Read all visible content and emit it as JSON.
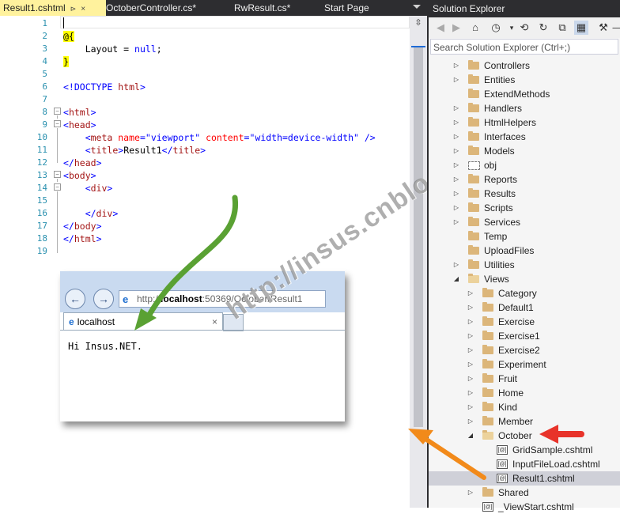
{
  "tabs": [
    {
      "label": "Result1.cshtml",
      "active": true
    },
    {
      "label": "OctoberController.cs*"
    },
    {
      "label": "RwResult.cs*"
    },
    {
      "label": "Start Page"
    }
  ],
  "tab_pin": "⊳",
  "tab_close": "×",
  "editor": {
    "line_numbers": [
      "1",
      "2",
      "3",
      "4",
      "5",
      "6",
      "7",
      "8",
      "9",
      "10",
      "11",
      "12",
      "13",
      "14",
      "15",
      "16",
      "17",
      "18",
      "19"
    ],
    "lines": {
      "l2": "@{",
      "l3a": "    Layout = ",
      "l3b": "null",
      "l3c": ";",
      "l4": "}",
      "l6a": "<!DOCTYPE ",
      "l6b": "html",
      "l6c": ">",
      "l8a": "<",
      "l8b": "html",
      "l8c": ">",
      "l9a": "<",
      "l9b": "head",
      "l9c": ">",
      "l10a": "    <",
      "l10b": "meta",
      "l10c": " name",
      "l10d": "=",
      "l10e": "\"viewport\"",
      "l10f": " content",
      "l10g": "=",
      "l10h": "\"width=device-width\"",
      "l10i": " />",
      "l11a": "    <",
      "l11b": "title",
      "l11c": ">",
      "l11d": "Result1",
      "l11e": "</",
      "l11f": "title",
      "l11g": ">",
      "l12a": "</",
      "l12b": "head",
      "l12c": ">",
      "l13a": "<",
      "l13b": "body",
      "l13c": ">",
      "l14a": "    <",
      "l14b": "div",
      "l14c": ">",
      "l16a": "    </",
      "l16b": "div",
      "l16c": ">",
      "l17a": "</",
      "l17b": "body",
      "l17c": ">",
      "l18a": "</",
      "l18b": "html",
      "l18c": ">"
    }
  },
  "browser": {
    "back": "←",
    "forward": "→",
    "ie_glyph": "e",
    "url_prefix": "http://",
    "url_host": "localhost",
    "url_rest": ":50369/October/Result1",
    "tab_label": "localhost",
    "tab_close": "×",
    "content": "Hi Insus.NET."
  },
  "watermark": "http://insus.cnblogs.com",
  "solution_explorer": {
    "title": "Solution Explorer",
    "search_placeholder": "Search Solution Explorer (Ctrl+;)",
    "toolbar_icons": [
      "back-icon",
      "forward-icon",
      "home-icon",
      "history-icon",
      "refresh-icon",
      "sync-icon",
      "collapse-icon",
      "show-all-icon",
      "properties-icon",
      "pin-icon"
    ],
    "items": [
      {
        "label": "Controllers",
        "level": 0,
        "expander": "collapsed",
        "kind": "folder"
      },
      {
        "label": "Entities",
        "level": 0,
        "expander": "collapsed",
        "kind": "folder"
      },
      {
        "label": "ExtendMethods",
        "level": 0,
        "expander": "none",
        "kind": "folder"
      },
      {
        "label": "Handlers",
        "level": 0,
        "expander": "collapsed",
        "kind": "folder"
      },
      {
        "label": "HtmlHelpers",
        "level": 0,
        "expander": "collapsed",
        "kind": "folder"
      },
      {
        "label": "Interfaces",
        "level": 0,
        "expander": "collapsed",
        "kind": "folder"
      },
      {
        "label": "Models",
        "level": 0,
        "expander": "collapsed",
        "kind": "folder"
      },
      {
        "label": "obj",
        "level": 0,
        "expander": "collapsed",
        "kind": "hidden-folder"
      },
      {
        "label": "Reports",
        "level": 0,
        "expander": "collapsed",
        "kind": "folder"
      },
      {
        "label": "Results",
        "level": 0,
        "expander": "collapsed",
        "kind": "folder"
      },
      {
        "label": "Scripts",
        "level": 0,
        "expander": "collapsed",
        "kind": "folder"
      },
      {
        "label": "Services",
        "level": 0,
        "expander": "collapsed",
        "kind": "folder"
      },
      {
        "label": "Temp",
        "level": 0,
        "expander": "none",
        "kind": "folder"
      },
      {
        "label": "UploadFiles",
        "level": 0,
        "expander": "none",
        "kind": "folder"
      },
      {
        "label": "Utilities",
        "level": 0,
        "expander": "collapsed",
        "kind": "folder"
      },
      {
        "label": "Views",
        "level": 0,
        "expander": "expanded",
        "kind": "open-folder"
      },
      {
        "label": "Category",
        "level": 1,
        "expander": "collapsed",
        "kind": "folder"
      },
      {
        "label": "Default1",
        "level": 1,
        "expander": "collapsed",
        "kind": "folder"
      },
      {
        "label": "Exercise",
        "level": 1,
        "expander": "collapsed",
        "kind": "folder"
      },
      {
        "label": "Exercise1",
        "level": 1,
        "expander": "collapsed",
        "kind": "folder"
      },
      {
        "label": "Exercise2",
        "level": 1,
        "expander": "collapsed",
        "kind": "folder"
      },
      {
        "label": "Experiment",
        "level": 1,
        "expander": "collapsed",
        "kind": "folder"
      },
      {
        "label": "Fruit",
        "level": 1,
        "expander": "collapsed",
        "kind": "folder"
      },
      {
        "label": "Home",
        "level": 1,
        "expander": "collapsed",
        "kind": "folder"
      },
      {
        "label": "Kind",
        "level": 1,
        "expander": "collapsed",
        "kind": "folder"
      },
      {
        "label": "Member",
        "level": 1,
        "expander": "collapsed",
        "kind": "folder"
      },
      {
        "label": "October",
        "level": 1,
        "expander": "expanded",
        "kind": "open-folder"
      },
      {
        "label": "GridSample.cshtml",
        "level": 2,
        "expander": "none",
        "kind": "file"
      },
      {
        "label": "InputFileLoad.cshtml",
        "level": 2,
        "expander": "none",
        "kind": "file"
      },
      {
        "label": "Result1.cshtml",
        "level": 2,
        "expander": "none",
        "kind": "file",
        "selected": true
      },
      {
        "label": "Shared",
        "level": 1,
        "expander": "collapsed",
        "kind": "folder"
      },
      {
        "label": "_ViewStart.cshtml",
        "level": 1,
        "expander": "none",
        "kind": "file"
      }
    ],
    "file_glyph": "[@]",
    "tri_collapsed": "▷",
    "tri_expanded": "◢"
  },
  "colors": {
    "green_arrow": "#5aa133",
    "orange_arrow": "#f28a1a",
    "red_arrow": "#e8332a"
  }
}
